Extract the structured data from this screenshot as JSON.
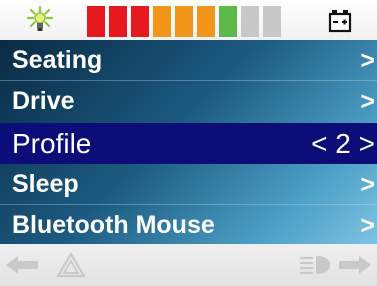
{
  "status": {
    "light_icon": "headlight-sun-icon",
    "battery_icon": "battery-icon",
    "battery_level_segments": 7,
    "battery_total_segments": 9,
    "segment_colors": [
      "#e5191e",
      "#e5191e",
      "#e5191e",
      "#f29619",
      "#f29619",
      "#f29619",
      "#5db84a",
      "#c8c8c8",
      "#c8c8c8"
    ]
  },
  "menu": {
    "items": [
      {
        "label": "Seating",
        "value": ">"
      },
      {
        "label": "Drive",
        "value": ">"
      },
      {
        "label": "Profile",
        "value": "< 2 >",
        "selected": true
      },
      {
        "label": "Sleep",
        "value": ">"
      },
      {
        "label": "Bluetooth Mouse",
        "value": ">"
      }
    ]
  },
  "bottom": {
    "icons": [
      "left-arrow-icon",
      "hazard-icon",
      "horn-light-icon",
      "right-arrow-icon"
    ]
  },
  "colors": {
    "selected_bg": "#0d0d7a",
    "text": "#ffffff"
  }
}
